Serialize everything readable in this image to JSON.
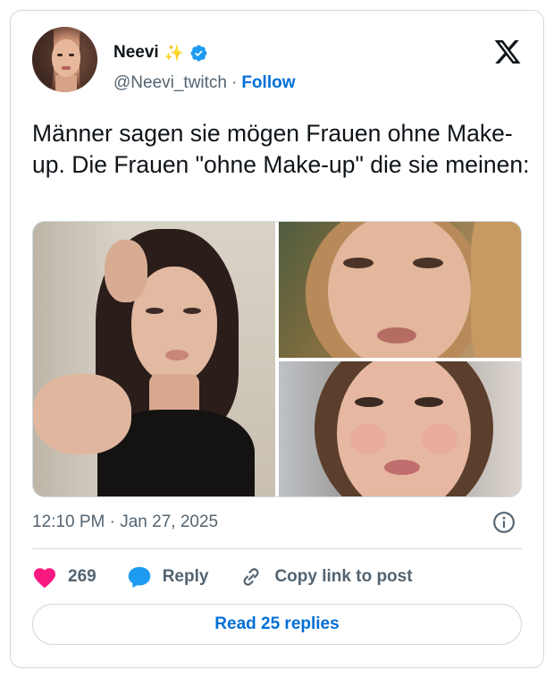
{
  "author": {
    "name": "Neevi",
    "name_emoji": "✨",
    "handle": "@Neevi_twitch",
    "separator": "·",
    "follow_label": "Follow",
    "verified": true
  },
  "tweet": {
    "text": "Männer sagen sie mögen Frauen ohne Make-up. Die Frauen \"ohne Make-up\" die sie meinen:",
    "timestamp": "12:10 PM · Jan 27, 2025",
    "photo_count": 3
  },
  "actions": {
    "like_count": "269",
    "reply_label": "Reply",
    "copy_label": "Copy link to post"
  },
  "read_replies_label": "Read 25 replies",
  "icons": {
    "like": "heart-icon",
    "reply": "speech-bubble-icon",
    "copy": "link-icon",
    "info": "info-icon",
    "brand": "x-logo-icon",
    "verified": "verified-badge-icon"
  },
  "colors": {
    "like": "#f91880",
    "reply": "#1d9bf0",
    "link": "#006fd6",
    "secondary_text": "#536471",
    "border": "#cfd9de"
  }
}
